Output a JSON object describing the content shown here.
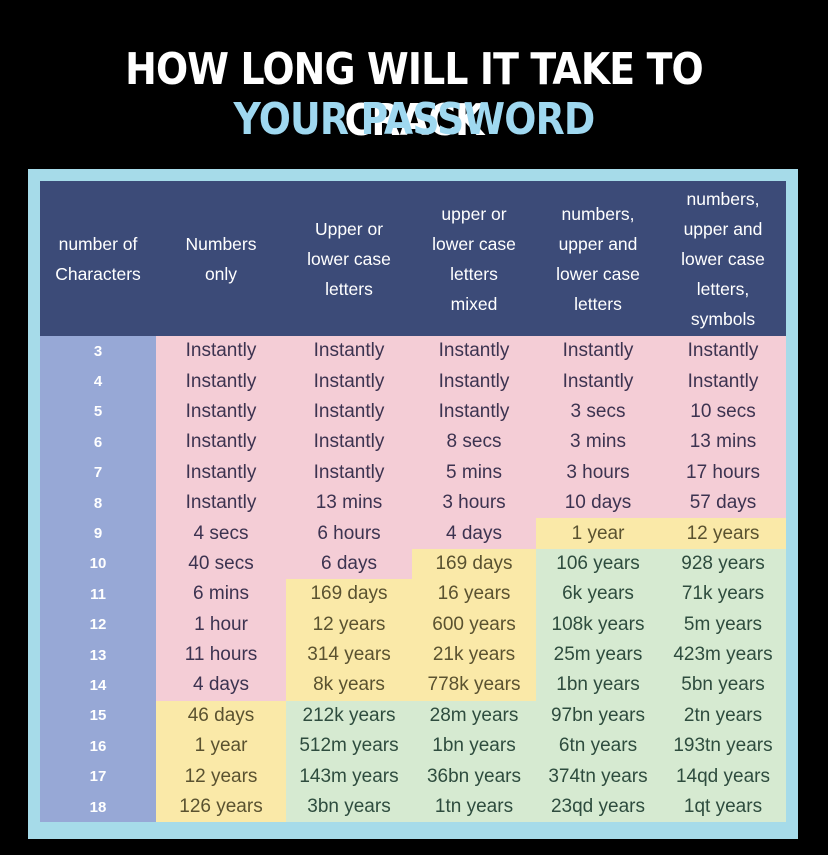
{
  "title": {
    "line1": "HOW LONG WILL IT TAKE TO CRACK",
    "line2": "YOUR PASSWORD"
  },
  "colors": {
    "header": "#3c4b78",
    "number_column": "#97a8d6",
    "instant": "#f4cdd6",
    "medium": "#fae9a8",
    "long": "#d6ead1",
    "frame": "#a6dbe9"
  },
  "table": {
    "headers": [
      "number of\nCharacters",
      "Numbers\nonly",
      "Upper or\nlower case\nletters",
      "upper or\nlower case\nletters\nmixed",
      "numbers,\nupper and\nlower case\nletters",
      "numbers,\nupper and\nlower case\nletters,\nsymbols"
    ],
    "rows": [
      {
        "chars": "3",
        "cells": [
          "Instantly",
          "Instantly",
          "Instantly",
          "Instantly",
          "Instantly"
        ],
        "tones": [
          "pink",
          "pink",
          "pink",
          "pink",
          "pink"
        ]
      },
      {
        "chars": "4",
        "cells": [
          "Instantly",
          "Instantly",
          "Instantly",
          "Instantly",
          "Instantly"
        ],
        "tones": [
          "pink",
          "pink",
          "pink",
          "pink",
          "pink"
        ]
      },
      {
        "chars": "5",
        "cells": [
          "Instantly",
          "Instantly",
          "Instantly",
          "3 secs",
          "10 secs"
        ],
        "tones": [
          "pink",
          "pink",
          "pink",
          "pink",
          "pink"
        ]
      },
      {
        "chars": "6",
        "cells": [
          "Instantly",
          "Instantly",
          "8 secs",
          "3 mins",
          "13 mins"
        ],
        "tones": [
          "pink",
          "pink",
          "pink",
          "pink",
          "pink"
        ]
      },
      {
        "chars": "7",
        "cells": [
          "Instantly",
          "Instantly",
          "5 mins",
          "3 hours",
          "17 hours"
        ],
        "tones": [
          "pink",
          "pink",
          "pink",
          "pink",
          "pink"
        ]
      },
      {
        "chars": "8",
        "cells": [
          "Instantly",
          "13 mins",
          "3 hours",
          "10 days",
          "57 days"
        ],
        "tones": [
          "pink",
          "pink",
          "pink",
          "pink",
          "pink"
        ]
      },
      {
        "chars": "9",
        "cells": [
          "4 secs",
          "6 hours",
          "4 days",
          "1 year",
          "12 years"
        ],
        "tones": [
          "pink",
          "pink",
          "pink",
          "yellow",
          "yellow"
        ]
      },
      {
        "chars": "10",
        "cells": [
          "40 secs",
          "6 days",
          "169 days",
          "106 years",
          "928 years"
        ],
        "tones": [
          "pink",
          "pink",
          "yellow",
          "green",
          "green"
        ]
      },
      {
        "chars": "11",
        "cells": [
          "6 mins",
          "169 days",
          "16 years",
          "6k years",
          "71k years"
        ],
        "tones": [
          "pink",
          "yellow",
          "yellow",
          "green",
          "green"
        ]
      },
      {
        "chars": "12",
        "cells": [
          "1 hour",
          "12 years",
          "600 years",
          "108k years",
          "5m years"
        ],
        "tones": [
          "pink",
          "yellow",
          "yellow",
          "green",
          "green"
        ]
      },
      {
        "chars": "13",
        "cells": [
          "11 hours",
          "314 years",
          "21k years",
          "25m years",
          "423m years"
        ],
        "tones": [
          "pink",
          "yellow",
          "yellow",
          "green",
          "green"
        ]
      },
      {
        "chars": "14",
        "cells": [
          "4 days",
          "8k years",
          "778k years",
          "1bn years",
          "5bn years"
        ],
        "tones": [
          "pink",
          "yellow",
          "yellow",
          "green",
          "green"
        ]
      },
      {
        "chars": "15",
        "cells": [
          "46 days",
          "212k years",
          "28m years",
          "97bn years",
          "2tn years"
        ],
        "tones": [
          "yellow",
          "green",
          "green",
          "green",
          "green"
        ]
      },
      {
        "chars": "16",
        "cells": [
          "1 year",
          "512m years",
          "1bn years",
          "6tn years",
          "193tn years"
        ],
        "tones": [
          "yellow",
          "green",
          "green",
          "green",
          "green"
        ]
      },
      {
        "chars": "17",
        "cells": [
          "12 years",
          "143m years",
          "36bn years",
          "374tn years",
          "14qd years"
        ],
        "tones": [
          "yellow",
          "green",
          "green",
          "green",
          "green"
        ]
      },
      {
        "chars": "18",
        "cells": [
          "126 years",
          "3bn years",
          "1tn years",
          "23qd years",
          "1qt years"
        ],
        "tones": [
          "yellow",
          "green",
          "green",
          "green",
          "green"
        ]
      }
    ]
  }
}
